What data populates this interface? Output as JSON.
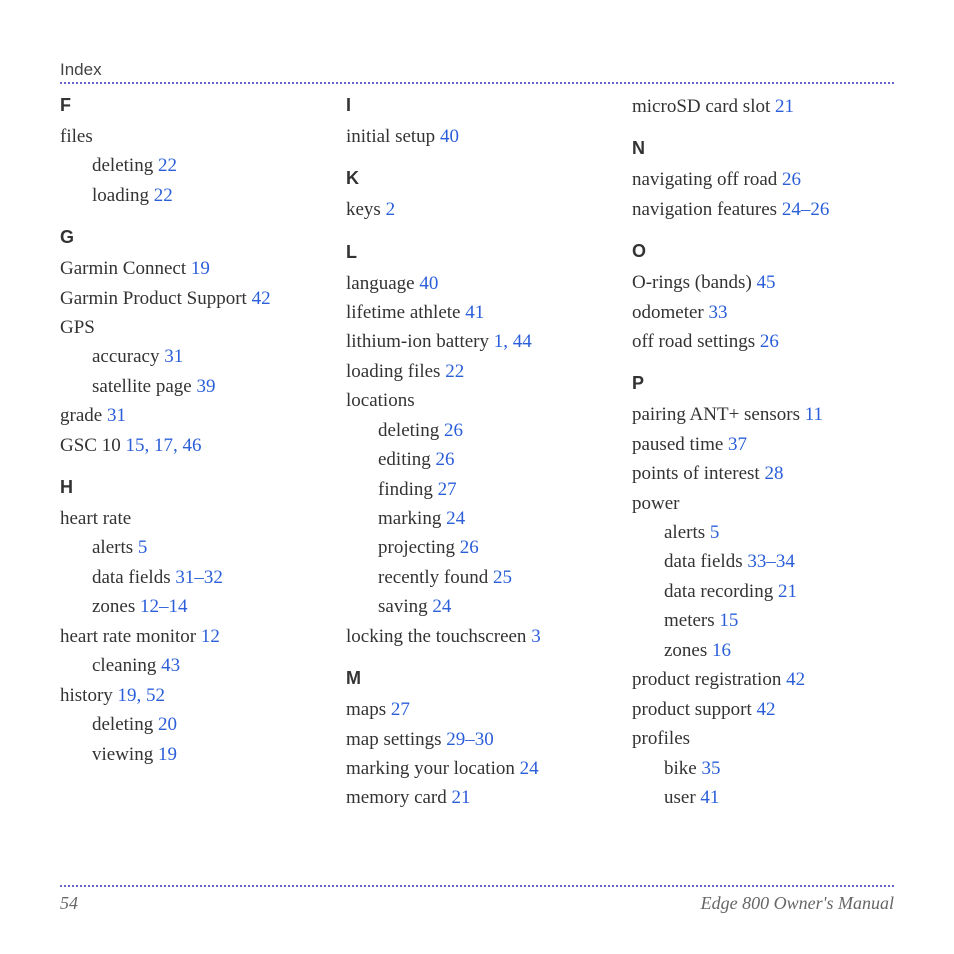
{
  "header": "Index",
  "footer": {
    "page": "54",
    "title": "Edge 800 Owner's Manual"
  },
  "columns": [
    [
      {
        "type": "letter",
        "text": "F",
        "first": true
      },
      {
        "type": "entry",
        "term": "files"
      },
      {
        "type": "sub",
        "term": "deleting",
        "pages": [
          22
        ]
      },
      {
        "type": "sub",
        "term": "loading",
        "pages": [
          22
        ]
      },
      {
        "type": "letter",
        "text": "G"
      },
      {
        "type": "entry",
        "term": "Garmin Connect",
        "pages": [
          19
        ]
      },
      {
        "type": "entry",
        "term": "Garmin Product Support",
        "pages": [
          42
        ]
      },
      {
        "type": "entry",
        "term": "GPS"
      },
      {
        "type": "sub",
        "term": "accuracy",
        "pages": [
          31
        ]
      },
      {
        "type": "sub",
        "term": "satellite page",
        "pages": [
          39
        ]
      },
      {
        "type": "entry",
        "term": "grade",
        "pages": [
          31
        ]
      },
      {
        "type": "entry",
        "term": "GSC 10",
        "pages": [
          15,
          17,
          46
        ]
      },
      {
        "type": "letter",
        "text": "H"
      },
      {
        "type": "entry",
        "term": "heart rate"
      },
      {
        "type": "sub",
        "term": "alerts",
        "pages": [
          5
        ]
      },
      {
        "type": "sub",
        "term": "data fields",
        "range": [
          31,
          32
        ]
      },
      {
        "type": "sub",
        "term": "zones",
        "range": [
          12,
          14
        ]
      },
      {
        "type": "entry",
        "term": "heart rate monitor",
        "pages": [
          12
        ]
      },
      {
        "type": "sub",
        "term": "cleaning",
        "pages": [
          43
        ]
      },
      {
        "type": "entry",
        "term": "history",
        "pages": [
          19,
          52
        ]
      },
      {
        "type": "sub",
        "term": "deleting",
        "pages": [
          20
        ]
      },
      {
        "type": "sub",
        "term": "viewing",
        "pages": [
          19
        ]
      }
    ],
    [
      {
        "type": "letter",
        "text": "I",
        "first": true
      },
      {
        "type": "entry",
        "term": "initial setup",
        "pages": [
          40
        ]
      },
      {
        "type": "letter",
        "text": "K"
      },
      {
        "type": "entry",
        "term": "keys",
        "pages": [
          2
        ]
      },
      {
        "type": "letter",
        "text": "L"
      },
      {
        "type": "entry",
        "term": "language",
        "pages": [
          40
        ]
      },
      {
        "type": "entry",
        "term": "lifetime athlete",
        "pages": [
          41
        ]
      },
      {
        "type": "entry",
        "term": "lithium-ion battery",
        "pages": [
          1,
          44
        ]
      },
      {
        "type": "entry",
        "term": "loading files",
        "pages": [
          22
        ]
      },
      {
        "type": "entry",
        "term": "locations"
      },
      {
        "type": "sub",
        "term": "deleting",
        "pages": [
          26
        ]
      },
      {
        "type": "sub",
        "term": "editing",
        "pages": [
          26
        ]
      },
      {
        "type": "sub",
        "term": "finding",
        "pages": [
          27
        ]
      },
      {
        "type": "sub",
        "term": "marking",
        "pages": [
          24
        ]
      },
      {
        "type": "sub",
        "term": "projecting",
        "pages": [
          26
        ]
      },
      {
        "type": "sub",
        "term": "recently found",
        "pages": [
          25
        ]
      },
      {
        "type": "sub",
        "term": "saving",
        "pages": [
          24
        ]
      },
      {
        "type": "entry",
        "term": "locking the touchscreen",
        "pages": [
          3
        ]
      },
      {
        "type": "letter",
        "text": "M"
      },
      {
        "type": "entry",
        "term": "maps",
        "pages": [
          27
        ]
      },
      {
        "type": "entry",
        "term": "map settings",
        "range": [
          29,
          30
        ]
      },
      {
        "type": "entry",
        "term": "marking your location",
        "pages": [
          24
        ]
      },
      {
        "type": "entry",
        "term": "memory card",
        "pages": [
          21
        ]
      }
    ],
    [
      {
        "type": "entry",
        "term": "microSD card slot",
        "pages": [
          21
        ],
        "first": true
      },
      {
        "type": "letter",
        "text": "N"
      },
      {
        "type": "entry",
        "term": "navigating off road",
        "pages": [
          26
        ]
      },
      {
        "type": "entry",
        "term": "navigation features",
        "range": [
          24,
          26
        ]
      },
      {
        "type": "letter",
        "text": "O"
      },
      {
        "type": "entry",
        "term": "O-rings (bands)",
        "pages": [
          45
        ]
      },
      {
        "type": "entry",
        "term": "odometer",
        "pages": [
          33
        ]
      },
      {
        "type": "entry",
        "term": "off road settings",
        "pages": [
          26
        ]
      },
      {
        "type": "letter",
        "text": "P"
      },
      {
        "type": "entry",
        "term": "pairing ANT+ sensors",
        "pages": [
          11
        ]
      },
      {
        "type": "entry",
        "term": "paused time",
        "pages": [
          37
        ]
      },
      {
        "type": "entry",
        "term": "points of interest",
        "pages": [
          28
        ]
      },
      {
        "type": "entry",
        "term": "power"
      },
      {
        "type": "sub",
        "term": "alerts",
        "pages": [
          5
        ]
      },
      {
        "type": "sub",
        "term": "data fields",
        "range": [
          33,
          34
        ]
      },
      {
        "type": "sub",
        "term": "data recording",
        "pages": [
          21
        ]
      },
      {
        "type": "sub",
        "term": "meters",
        "pages": [
          15
        ]
      },
      {
        "type": "sub",
        "term": "zones",
        "pages": [
          16
        ]
      },
      {
        "type": "entry",
        "term": "product registration",
        "pages": [
          42
        ]
      },
      {
        "type": "entry",
        "term": "product support",
        "pages": [
          42
        ]
      },
      {
        "type": "entry",
        "term": "profiles"
      },
      {
        "type": "sub",
        "term": "bike",
        "pages": [
          35
        ]
      },
      {
        "type": "sub",
        "term": "user",
        "pages": [
          41
        ]
      }
    ]
  ]
}
